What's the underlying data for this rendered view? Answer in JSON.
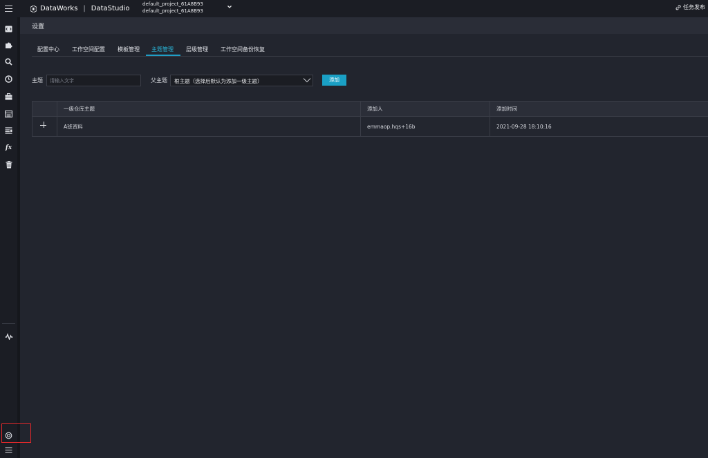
{
  "topbar": {
    "brand": "DataWorks",
    "separator": "|",
    "product": "DataStudio",
    "project_line1": "default_project_61A8B93",
    "project_line2": "default_project_61A8B93",
    "publish_label": "任务发布"
  },
  "sidebar": {
    "icons": [
      "code-icon",
      "puzzle-icon",
      "search-icon",
      "clock-icon",
      "briefcase-icon",
      "table-icon",
      "list-icon",
      "function-icon",
      "trash-icon",
      "pulse-icon",
      "settings-icon",
      "menu-icon"
    ],
    "function_glyph": "fx"
  },
  "header": {
    "title": "设置"
  },
  "tabs": [
    {
      "label": "配置中心"
    },
    {
      "label": "工作空间配置"
    },
    {
      "label": "模板管理"
    },
    {
      "label": "主题管理"
    },
    {
      "label": "层级管理"
    },
    {
      "label": "工作空间备份恢复"
    }
  ],
  "active_tab": "主题管理",
  "form": {
    "topic_label": "主题",
    "topic_placeholder": "请输入文字",
    "parent_label": "父主题",
    "parent_value": "根主题（选择后默认为添加一级主题）",
    "add_button": "添加"
  },
  "table": {
    "headers": [
      "一级仓库主题",
      "添加人",
      "添加时间"
    ],
    "rows": [
      {
        "topic": "A班资料",
        "added_by": "emmaop.hqs+16b",
        "added_time": "2021-09-28 18:10:16"
      }
    ]
  },
  "colors": {
    "accent": "#1aa0c5",
    "highlight_box": "#e8292b",
    "background": "#22252e"
  }
}
